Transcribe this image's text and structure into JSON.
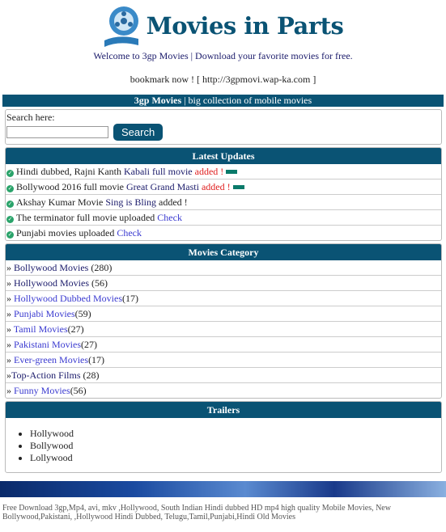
{
  "header": {
    "logo_text": "Movies in Parts",
    "welcome": "Welcome to 3gp Movies | Download your favorite movies for free.",
    "bookmark": "bookmark now ! [ http://3gpmovi.wap-ka.com ]"
  },
  "topbar": {
    "brand": "3gp Movies",
    "tagline": " | big collection of mobile movies"
  },
  "search": {
    "label": "Search here:",
    "value": "",
    "button": "Search"
  },
  "latest": {
    "title": "Latest Updates",
    "items": [
      {
        "pre": "Hindi dubbed, Rajni Kanth ",
        "link": "Kabali full movie",
        "post": " added !",
        "new": true
      },
      {
        "pre": "Bollywood 2016 full movie ",
        "link": "Great Grand Masti",
        "post": " added !",
        "new": true
      },
      {
        "pre": "Akshay Kumar Movie ",
        "link": "Sing is Bling",
        "post": " added !",
        "new": false
      },
      {
        "pre": "The terminator full movie uploaded ",
        "link": "Check",
        "post": "",
        "new": false
      },
      {
        "pre": "Punjabi movies uploaded ",
        "link": "Check",
        "post": "",
        "new": false
      }
    ]
  },
  "categories": {
    "title": "Movies Category",
    "items": [
      {
        "prefix": "» ",
        "name": "Bollywood Movies",
        "count": " (280)"
      },
      {
        "prefix": "» ",
        "name": "Hollywood Movies",
        "count": " (56)"
      },
      {
        "prefix": "» ",
        "name": "Hollywood Dubbed Movies",
        "count": "(17)"
      },
      {
        "prefix": "» ",
        "name": "Punjabi Movies",
        "count": "(59)"
      },
      {
        "prefix": "» ",
        "name": "Tamil Movies",
        "count": "(27)"
      },
      {
        "prefix": "» ",
        "name": "Pakistani Movies",
        "count": "(27)"
      },
      {
        "prefix": "» ",
        "name": "Ever-green Movies",
        "count": "(17)"
      },
      {
        "prefix": "»",
        "name": "Top-Action Films",
        "count": " (28)"
      },
      {
        "prefix": "» ",
        "name": "Funny Movies",
        "count": "(56)"
      }
    ]
  },
  "trailers": {
    "title": "Trailers",
    "items": [
      "Hollywood",
      "Bollywood",
      "Lollywood"
    ]
  },
  "footer": {
    "text": "Free Download 3gp,Mp4, avi, mkv ,Hollywood, South Indian Hindi dubbed HD mp4 high quality Mobile Movies, New Bollywood,Pakistani, ,Hollywood Hindi Dubbed, Telugu,Tamil,Punjabi,Hindi Old Movies"
  },
  "colors": {
    "accent": "#0a5374",
    "added": "#e02020",
    "link": "#3a3ad0"
  }
}
